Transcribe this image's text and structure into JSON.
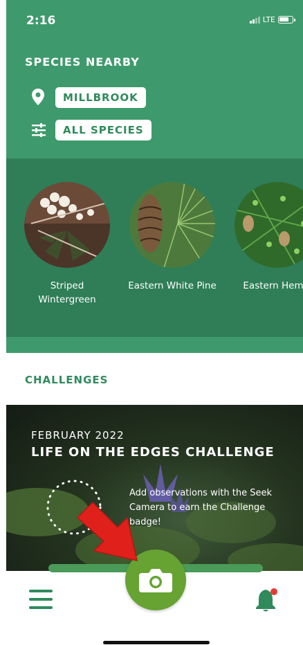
{
  "status_bar": {
    "time": "2:16",
    "network": "LTE"
  },
  "header": {
    "title": "SPECIES NEARBY",
    "location": "MILLBROOK",
    "filter": "ALL SPECIES"
  },
  "species": [
    {
      "name": "Striped\nWintergreen"
    },
    {
      "name": "Eastern White Pine"
    },
    {
      "name": "Eastern Hemlo"
    }
  ],
  "challenges": {
    "title": "CHALLENGES",
    "card": {
      "month": "FEBRUARY 2022",
      "title": "LIFE ON THE EDGES CHALLENGE",
      "description": "Add observations with the Seek Camera to earn the Challenge badge!"
    }
  },
  "colors": {
    "header_green": "#3e9a6c",
    "strip_green": "#2f7e57",
    "accent_green": "#2f8a5c",
    "camera_green": "#66a332",
    "arrow_red": "#e0211b"
  },
  "icons": [
    "location-pin-icon",
    "filter-sliders-icon",
    "menu-icon",
    "camera-icon",
    "bell-icon",
    "red-arrow-annotation"
  ]
}
